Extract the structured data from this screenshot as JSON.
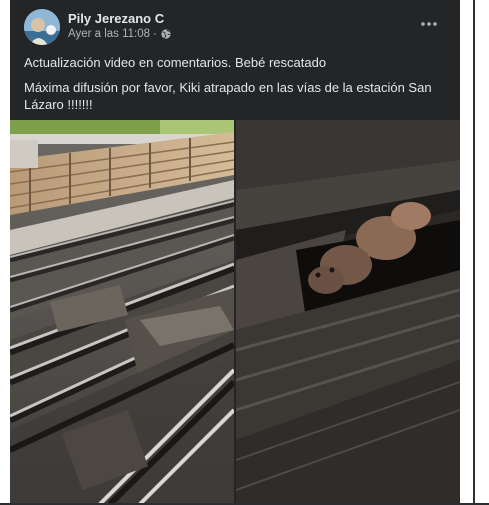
{
  "post": {
    "author": "Pily Jerezano C",
    "timestamp": "Ayer a las 11:08",
    "separator": "·",
    "privacy_icon": "globe-icon",
    "menu_icon": "more-horizontal-icon",
    "paragraphs": [
      "Actualización video en comentarios. Bebé rescatado",
      "Máxima difusión por favor, Kiki atrapado en las vías de la estación San Lázaro !!!!!!!"
    ],
    "photos": [
      {
        "subject": "metro-tracks-photo"
      },
      {
        "subject": "trapped-kitten-photo"
      }
    ]
  },
  "colors": {
    "card_bg": "#242526",
    "primary_text": "#e4e6eb",
    "secondary_text": "#b0b3b8"
  }
}
